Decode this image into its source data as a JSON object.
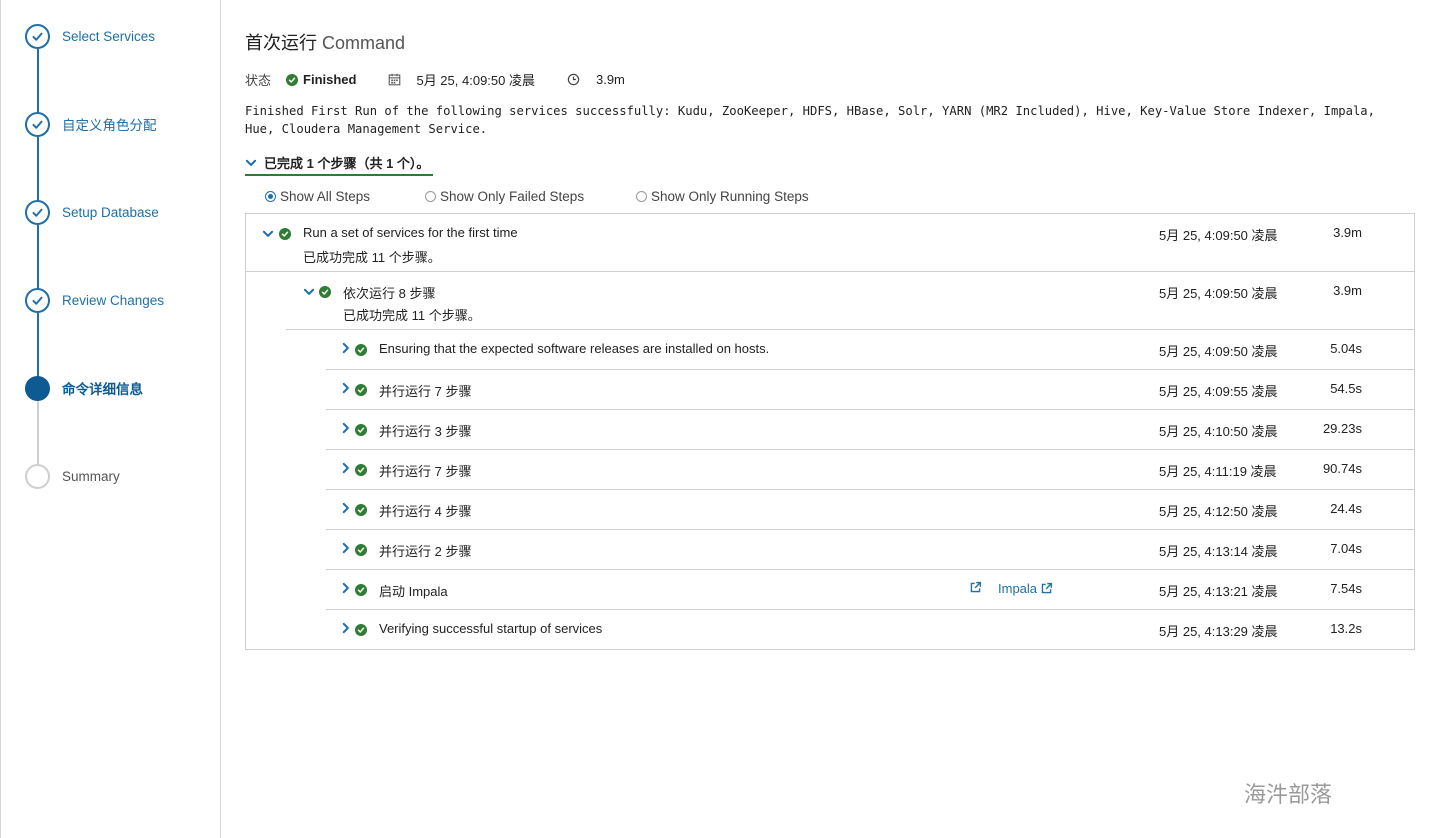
{
  "wizard": {
    "steps": [
      {
        "label": "Select Services",
        "state": "done"
      },
      {
        "label": "自定义角色分配",
        "state": "done"
      },
      {
        "label": "Setup Database",
        "state": "done"
      },
      {
        "label": "Review Changes",
        "state": "done"
      },
      {
        "label": "命令详细信息",
        "state": "active"
      },
      {
        "label": "Summary",
        "state": "pending"
      }
    ]
  },
  "header": {
    "title_cn": "首次运行",
    "title_en": "Command"
  },
  "status": {
    "label": "状态",
    "value": "Finished",
    "time": "5月 25, 4:09:50 凌晨",
    "duration": "3.9m"
  },
  "summary_text": "Finished First Run of the following services successfully: Kudu, ZooKeeper, HDFS, HBase, Solr, YARN (MR2 Included), Hive, Key-Value Store Indexer, Impala, Hue, Cloudera Management Service.",
  "progress_header": "已完成 1 个步骤（共 1 个）。",
  "filters": [
    {
      "label": "Show All Steps",
      "checked": true
    },
    {
      "label": "Show Only Failed Steps",
      "checked": false
    },
    {
      "label": "Show Only Running Steps",
      "checked": false
    }
  ],
  "steps": {
    "root": {
      "title": "Run a set of services for the first time",
      "sub": "已成功完成  11  个步骤。",
      "time": "5月 25, 4:09:50 凌晨",
      "duration": "3.9m"
    },
    "group": {
      "title": "依次运行 8 步骤",
      "sub": "已成功完成  11  个步骤。",
      "time": "5月 25, 4:09:50 凌晨",
      "duration": "3.9m"
    },
    "children": [
      {
        "title": "Ensuring that the expected software releases are installed on hosts.",
        "time": "5月 25, 4:09:50 凌晨",
        "duration": "5.04s"
      },
      {
        "title": "并行运行 7 步骤",
        "time": "5月 25, 4:09:55 凌晨",
        "duration": "54.5s"
      },
      {
        "title": "并行运行 3 步骤",
        "time": "5月 25, 4:10:50 凌晨",
        "duration": "29.23s"
      },
      {
        "title": "并行运行 7 步骤",
        "time": "5月 25, 4:11:19 凌晨",
        "duration": "90.74s"
      },
      {
        "title": "并行运行 4 步骤",
        "time": "5月 25, 4:12:50 凌晨",
        "duration": "24.4s"
      },
      {
        "title": "并行运行 2 步骤",
        "time": "5月 25, 4:13:14 凌晨",
        "duration": "7.04s"
      },
      {
        "title": "启动 Impala",
        "time": "5月 25, 4:13:21 凌晨",
        "duration": "7.54s",
        "role_link": "Impala"
      },
      {
        "title": "Verifying successful startup of services",
        "time": "5月 25, 4:13:29 凌晨",
        "duration": "13.2s"
      }
    ]
  },
  "watermark": "海汼部落",
  "colors": {
    "accent": "#1f6fa8",
    "active": "#0e5a93",
    "success": "#2e7d32",
    "border": "#cfcfcf"
  }
}
